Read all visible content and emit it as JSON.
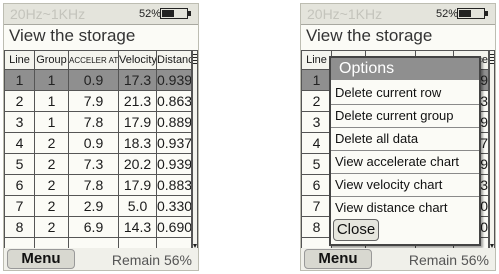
{
  "status": {
    "freq_range": "20Hz~1KHz",
    "battery_pct": "52%",
    "battery_level": 0.52
  },
  "page_title": "View the storage",
  "table": {
    "headers": [
      "Line",
      "Group",
      "ACCELER ATE",
      "Velocity",
      "Distance"
    ],
    "headers_partial": [
      "Line",
      "",
      "",
      "",
      "ance"
    ],
    "rows": [
      [
        "1",
        "1",
        "0.9",
        "17.3",
        "0.939"
      ],
      [
        "2",
        "1",
        "7.9",
        "21.3",
        "0.863"
      ],
      [
        "3",
        "1",
        "7.8",
        "17.9",
        "0.889"
      ],
      [
        "4",
        "2",
        "0.9",
        "18.3",
        "0.937"
      ],
      [
        "5",
        "2",
        "7.3",
        "20.2",
        "0.939"
      ],
      [
        "6",
        "2",
        "7.8",
        "17.9",
        "0.883"
      ],
      [
        "7",
        "2",
        "2.9",
        "5.0",
        "0.330"
      ],
      [
        "8",
        "2",
        "6.9",
        "14.3",
        "0.690"
      ]
    ],
    "rows_partial": [
      [
        "1",
        "39"
      ],
      [
        "2",
        "63"
      ],
      [
        "3",
        "89"
      ],
      [
        "4",
        "37"
      ],
      [
        "5",
        "39"
      ],
      [
        "6",
        "83"
      ],
      [
        "7",
        "30"
      ],
      [
        "8",
        "90"
      ]
    ],
    "selected_row": 0
  },
  "bottom": {
    "menu_label": "Menu",
    "remain_label": "Remain",
    "remain_value": "56%"
  },
  "options_dialog": {
    "title": "Options",
    "items": [
      "Delete current row",
      "Delete current group",
      "Delete all data",
      "View accelerate chart",
      "View velocity chart",
      "View distance chart"
    ],
    "close_label": "Close"
  },
  "colors": {
    "selected_row": "#8f8f8f",
    "dialog_title_bar": "#8f8f8f",
    "faded_header_text": "#c4c4bc"
  }
}
